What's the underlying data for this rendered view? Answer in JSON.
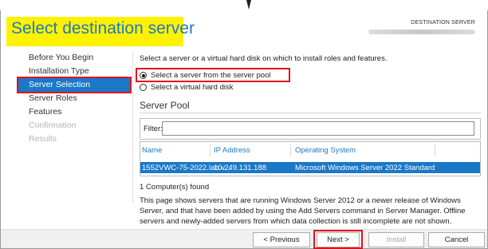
{
  "page": {
    "title": "Select destination server",
    "destination_label": "DESTINATION SERVER"
  },
  "nav": {
    "items": [
      {
        "label": "Before You Begin",
        "state": "normal"
      },
      {
        "label": "Installation Type",
        "state": "normal"
      },
      {
        "label": "Server Selection",
        "state": "active"
      },
      {
        "label": "Server Roles",
        "state": "normal"
      },
      {
        "label": "Features",
        "state": "normal"
      },
      {
        "label": "Confirmation",
        "state": "disabled"
      },
      {
        "label": "Results",
        "state": "disabled"
      }
    ]
  },
  "main": {
    "intro": "Select a server or a virtual hard disk on which to install roles and features.",
    "options": [
      {
        "label": "Select a server from the server pool",
        "checked": true
      },
      {
        "label": "Select a virtual hard disk",
        "checked": false
      }
    ],
    "pool_title": "Server Pool",
    "filter_label": "Filter:",
    "filter_value": "",
    "table": {
      "headers": [
        "Name",
        "IP Address",
        "Operating System"
      ],
      "rows": [
        [
          "1552VWC-75-2022.lab.v...",
          "10.249.131.188",
          "Microsoft Windows Server 2022 Standard"
        ]
      ]
    },
    "found": "1 Computer(s) found",
    "description": "This page shows servers that are running Windows Server 2012 or a newer release of Windows Server, and that have been added by using the Add Servers command in Server Manager. Offline servers and newly-added servers from which data collection is still incomplete are not shown."
  },
  "footer": {
    "previous": "< Previous",
    "next": "Next >",
    "install": "Install",
    "cancel": "Cancel"
  },
  "colors": {
    "accent": "#1a78c7",
    "title": "#1b79c5",
    "highlight_yellow": "#fff200",
    "annotation_red": "#e0121e"
  },
  "icons": {
    "pointer_arrow": "down-arrow-icon"
  }
}
